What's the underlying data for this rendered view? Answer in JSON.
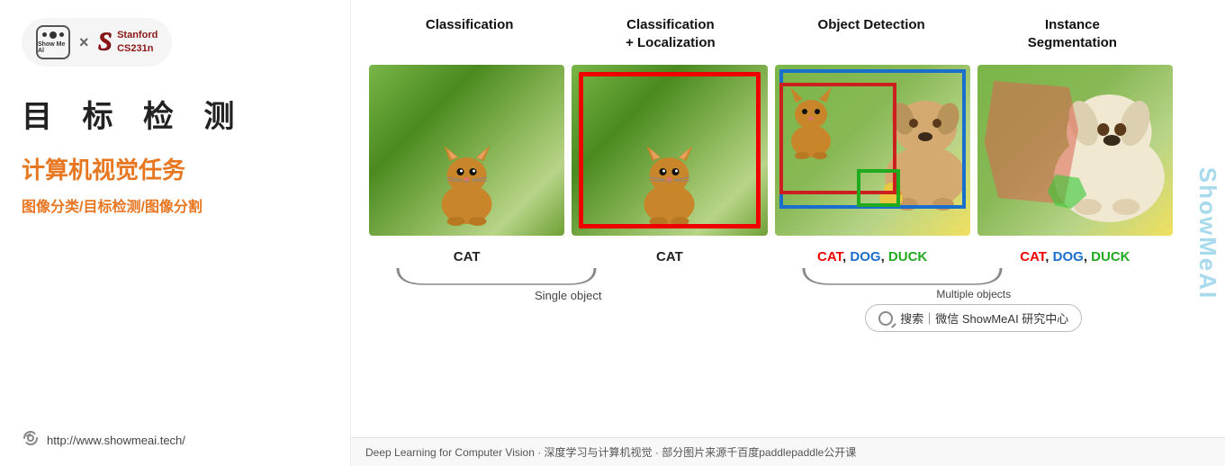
{
  "left": {
    "showmeai_label": "Show Me Al",
    "times": "×",
    "stanford_s": "S",
    "stanford_line1": "Stanford",
    "stanford_line2": "CS231n",
    "chinese_title": "目  标  检  测",
    "subtitle_main": "计算机视觉任务",
    "subtitle_sub": "图像分类/目标检测/图像分割",
    "url": "http://www.showmeai.tech/"
  },
  "right": {
    "watermark": "ShowMeAI",
    "cols": [
      {
        "label": "Classification"
      },
      {
        "label": "Classification\n+ Localization"
      },
      {
        "label": "Object Detection"
      },
      {
        "label": "Instance\nSegmentation"
      }
    ],
    "cat_label_1": "CAT",
    "cat_label_2": "CAT",
    "detect_labels": "CAT, DOG, DUCK",
    "seg_labels": "CAT, DOG, DUCK",
    "brace_single": "Single object",
    "brace_multiple": "Multiple objects",
    "search_text": "搜索｜微信  ShowMeAI 研究中心",
    "footer": "Deep Learning for Computer Vision · 深度学习与计算机视觉 · 部分图片来源千百度paddlepaddle公开课"
  }
}
